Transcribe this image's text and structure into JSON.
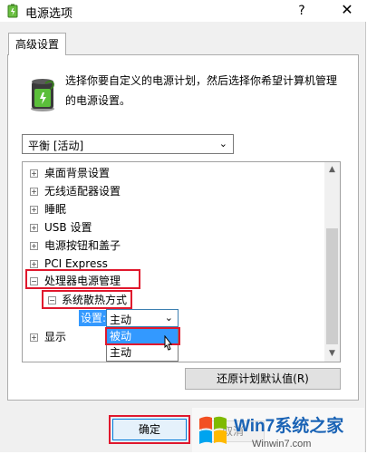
{
  "window": {
    "title": "电源选项",
    "help": "?",
    "close": "✕"
  },
  "tab": {
    "label": "高级设置"
  },
  "description": "选择你要自定义的电源计划，然后选择你希望计算机管理的电源设置。",
  "plan_select": {
    "value": "平衡 [活动]"
  },
  "tree": {
    "items": [
      {
        "label": "桌面背景设置",
        "toggle": "+"
      },
      {
        "label": "无线适配器设置",
        "toggle": "+"
      },
      {
        "label": "睡眠",
        "toggle": "+"
      },
      {
        "label": "USB 设置",
        "toggle": "+"
      },
      {
        "label": "电源按钮和盖子",
        "toggle": "+"
      },
      {
        "label": "PCI Express",
        "toggle": "+"
      },
      {
        "label": "处理器电源管理",
        "toggle": "−"
      },
      {
        "label": "系统散热方式",
        "toggle": "−"
      },
      {
        "label": "显示",
        "toggle": "+"
      }
    ],
    "setting_label": "设置:",
    "setting_value": "主动",
    "options": [
      "被动",
      "主动"
    ]
  },
  "restore_button": "还原计划默认值(R)",
  "ok_button": "确定",
  "cancel_button": "取消",
  "watermark": {
    "brand": "Win7系统之家",
    "url": "Winwin7.com"
  },
  "colors": {
    "highlight": "#3399ff",
    "annotation_red": "#e0182d",
    "accent_blue": "#0078d7"
  }
}
